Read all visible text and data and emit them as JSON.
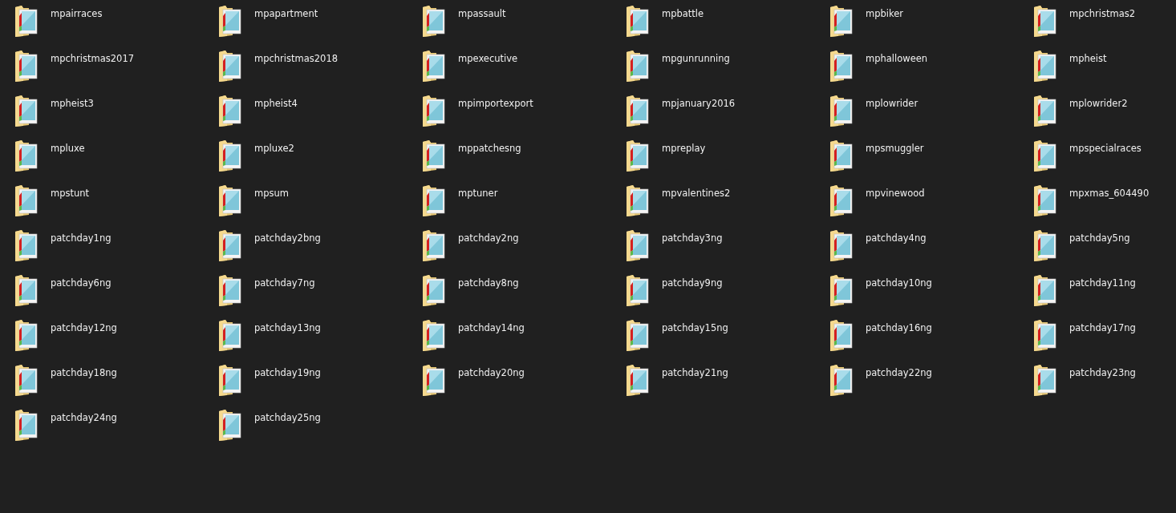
{
  "folders": [
    {
      "name": "mpairraces"
    },
    {
      "name": "mpapartment"
    },
    {
      "name": "mpassault"
    },
    {
      "name": "mpbattle"
    },
    {
      "name": "mpbiker"
    },
    {
      "name": "mpchristmas2"
    },
    {
      "name": "mpchristmas2017"
    },
    {
      "name": "mpchristmas2018"
    },
    {
      "name": "mpexecutive"
    },
    {
      "name": "mpgunrunning"
    },
    {
      "name": "mphalloween"
    },
    {
      "name": "mpheist"
    },
    {
      "name": "mpheist3"
    },
    {
      "name": "mpheist4"
    },
    {
      "name": "mpimportexport"
    },
    {
      "name": "mpjanuary2016"
    },
    {
      "name": "mplowrider"
    },
    {
      "name": "mplowrider2"
    },
    {
      "name": "mpluxe"
    },
    {
      "name": "mpluxe2"
    },
    {
      "name": "mppatchesng"
    },
    {
      "name": "mpreplay"
    },
    {
      "name": "mpsmuggler"
    },
    {
      "name": "mpspecialraces"
    },
    {
      "name": "mpstunt"
    },
    {
      "name": "mpsum"
    },
    {
      "name": "mptuner"
    },
    {
      "name": "mpvalentines2"
    },
    {
      "name": "mpvinewood"
    },
    {
      "name": "mpxmas_604490"
    },
    {
      "name": "patchday1ng"
    },
    {
      "name": "patchday2bng"
    },
    {
      "name": "patchday2ng"
    },
    {
      "name": "patchday3ng"
    },
    {
      "name": "patchday4ng"
    },
    {
      "name": "patchday5ng"
    },
    {
      "name": "patchday6ng"
    },
    {
      "name": "patchday7ng"
    },
    {
      "name": "patchday8ng"
    },
    {
      "name": "patchday9ng"
    },
    {
      "name": "patchday10ng"
    },
    {
      "name": "patchday11ng"
    },
    {
      "name": "patchday12ng"
    },
    {
      "name": "patchday13ng"
    },
    {
      "name": "patchday14ng"
    },
    {
      "name": "patchday15ng"
    },
    {
      "name": "patchday16ng"
    },
    {
      "name": "patchday17ng"
    },
    {
      "name": "patchday18ng"
    },
    {
      "name": "patchday19ng"
    },
    {
      "name": "patchday20ng"
    },
    {
      "name": "patchday21ng"
    },
    {
      "name": "patchday22ng"
    },
    {
      "name": "patchday23ng"
    },
    {
      "name": "patchday24ng"
    },
    {
      "name": "patchday25ng"
    }
  ]
}
